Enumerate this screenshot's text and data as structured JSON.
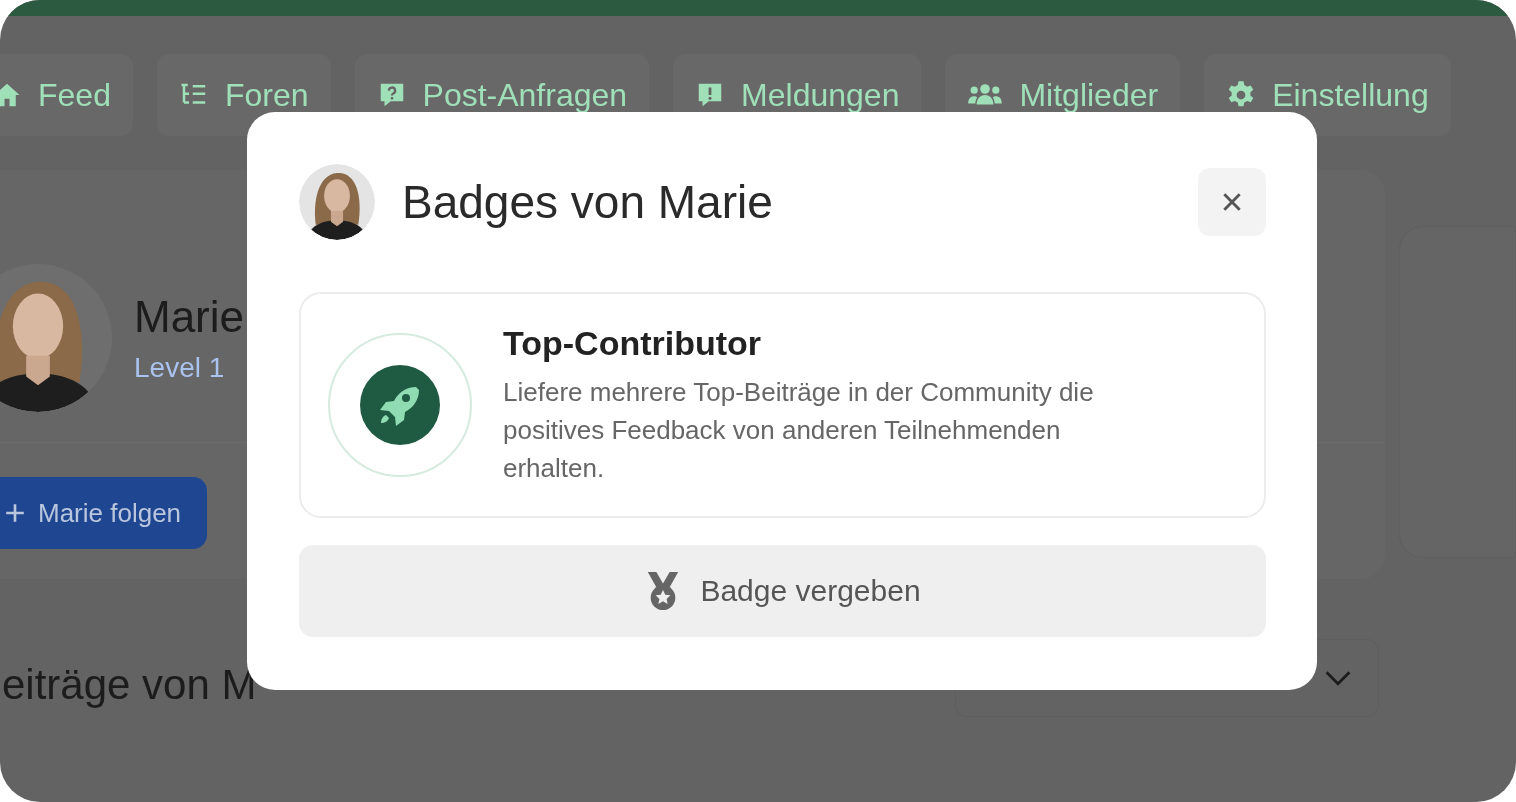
{
  "tabs": [
    {
      "label": "Feed"
    },
    {
      "label": "Foren"
    },
    {
      "label": "Post-Anfragen"
    },
    {
      "label": "Meldungen"
    },
    {
      "label": "Mitglieder"
    },
    {
      "label": "Einstellung"
    }
  ],
  "profile": {
    "name": "Marie",
    "level": "Level 1",
    "follow_button": "Marie folgen"
  },
  "posts": {
    "heading": "eiträge von M"
  },
  "modal": {
    "title": "Badges von Marie",
    "badges": [
      {
        "title": "Top-Contributor",
        "description": "Liefere mehrere Top-Beiträge in der Community die positives Feedback von anderen Teilnehmenden erhalten."
      }
    ],
    "action_button": "Badge vergeben"
  }
}
